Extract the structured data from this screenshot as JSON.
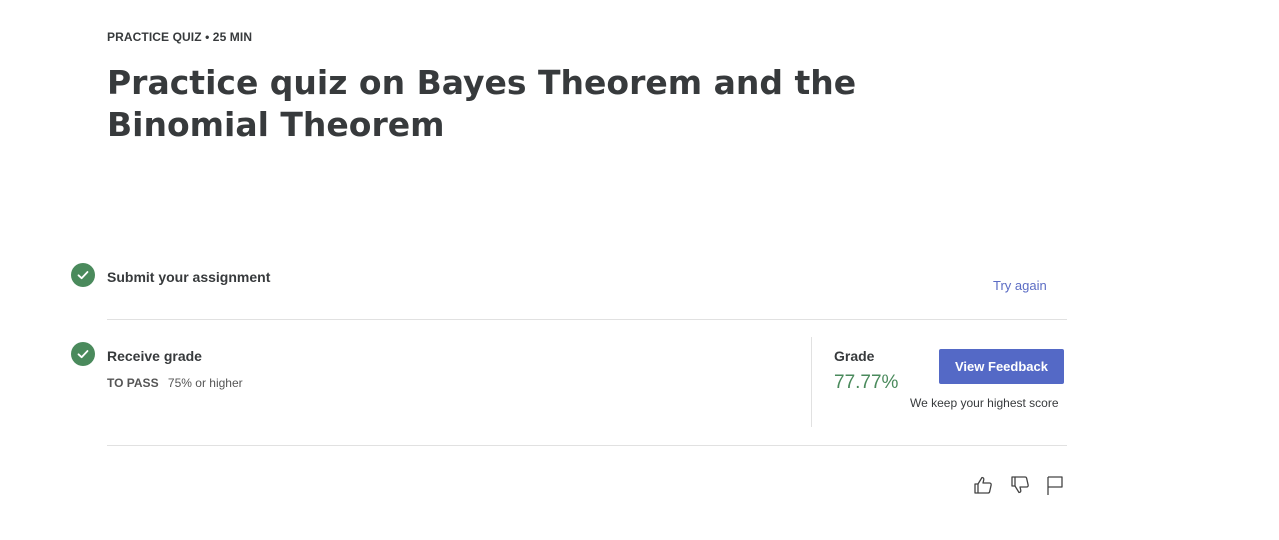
{
  "header": {
    "eyebrow": "PRACTICE QUIZ • 25 MIN",
    "title": "Practice quiz on Bayes Theorem and the Binomial Theorem"
  },
  "steps": [
    {
      "title": "Submit your assignment",
      "status": "complete",
      "action_label": "Try again"
    },
    {
      "title": "Receive grade",
      "status": "complete",
      "pass_label": "TO PASS",
      "pass_value": "75% or higher"
    }
  ],
  "grade": {
    "label": "Grade",
    "value": "77.77%",
    "button_label": "View Feedback",
    "note": "We keep your highest score"
  },
  "feedback_icons": [
    "thumbs-up-icon",
    "thumbs-down-icon",
    "flag-icon"
  ],
  "colors": {
    "check_green": "#4a8a5c",
    "grade_green": "#4a8a5c",
    "button_blue": "#5469c6",
    "link_blue": "#5b6cc4",
    "text": "#373a3c"
  }
}
